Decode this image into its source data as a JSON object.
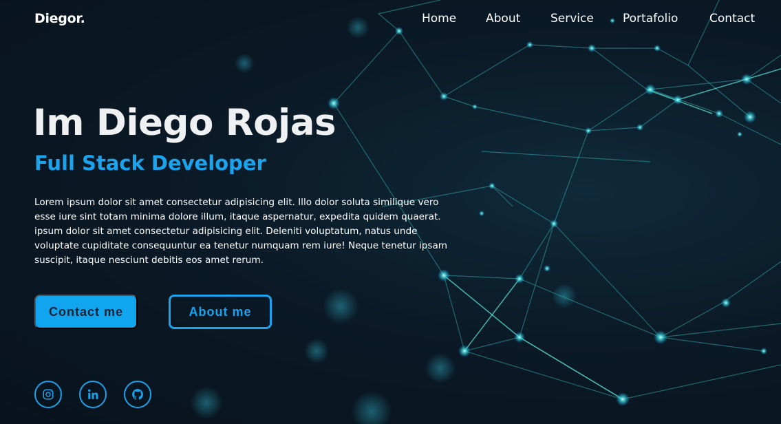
{
  "nav": {
    "logo": "Diegor.",
    "links": [
      "Home",
      "About",
      "Service",
      "Portafolio",
      "Contact"
    ]
  },
  "hero": {
    "title": "Im Diego Rojas",
    "subtitle": "Full Stack Developer",
    "description": "Lorem ipsum dolor sit amet consectetur adipisicing elit. Illo dolor soluta similique vero esse iure sint totam minima dolore illum, itaque aspernatur, expedita quidem quaerat. ipsum dolor sit amet consectetur adipisicing elit. Deleniti voluptatum, natus unde voluptate cupiditate consequuntur ea tenetur numquam rem iure! Neque tenetur ipsam suscipit, itaque nesciunt debitis eos amet rerum.",
    "contact_button": "Contact me",
    "about_button": "About me"
  },
  "social": [
    "instagram-icon",
    "linkedin-icon",
    "github-icon"
  ],
  "colors": {
    "accent": "#1aa4ee",
    "background": "#0b1622",
    "button_text": "#0c2233"
  }
}
